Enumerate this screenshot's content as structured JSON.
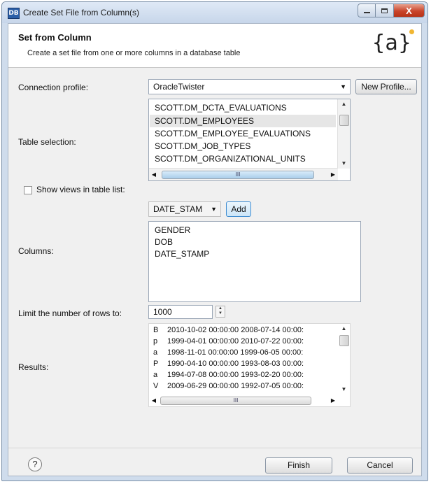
{
  "window": {
    "title": "Create Set File from Column(s)",
    "app_icon": "DB",
    "close_glyph": "X"
  },
  "header": {
    "title": "Set from Column",
    "description": "Create a set file from one or more columns in a database table",
    "logo": "{a}"
  },
  "connection": {
    "label": "Connection profile:",
    "value": "OracleTwister",
    "new_profile_label": "New Profile..."
  },
  "tables": {
    "label": "Table selection:",
    "items": [
      "SCOTT.DM_DCTA_EVALUATIONS",
      "SCOTT.DM_EMPLOYEES",
      "SCOTT.DM_EMPLOYEE_EVALUATIONS",
      "SCOTT.DM_JOB_TYPES",
      "SCOTT.DM_ORGANIZATIONAL_UNITS"
    ],
    "selected_index": 1,
    "hscroll_grip": "III"
  },
  "show_views": {
    "label": "Show views in table list:",
    "checked": false
  },
  "columns": {
    "label": "Columns:",
    "select_value": "DATE_STAM",
    "add_label": "Add",
    "items": [
      "GENDER",
      "DOB",
      "DATE_STAMP"
    ]
  },
  "limit": {
    "label": "Limit the number of rows to:",
    "value": "1000"
  },
  "results": {
    "label": "Results:",
    "rows": [
      {
        "c1": "B",
        "c2": "2010-10-02 00:00:00 2008-07-14 00:00:"
      },
      {
        "c1": "p",
        "c2": "1999-04-01 00:00:00 2010-07-22 00:00:"
      },
      {
        "c1": "a",
        "c2": "1998-11-01 00:00:00 1999-06-05 00:00:"
      },
      {
        "c1": "P",
        "c2": "1990-04-10 00:00:00 1993-08-03 00:00:"
      },
      {
        "c1": "a",
        "c2": "1994-07-08 00:00:00 1993-02-20 00:00:"
      },
      {
        "c1": "V",
        "c2": "2009-06-29 00:00:00 1992-07-05 00:00:"
      }
    ],
    "hscroll_grip": "III"
  },
  "footer": {
    "help_glyph": "?",
    "finish_label": "Finish",
    "cancel_label": "Cancel"
  },
  "colors": {
    "titlebar": "#c7d6ea",
    "close_button": "#c9452b",
    "dialog_bg": "#f0f0f0",
    "selected_row": "#e6e6e6"
  }
}
